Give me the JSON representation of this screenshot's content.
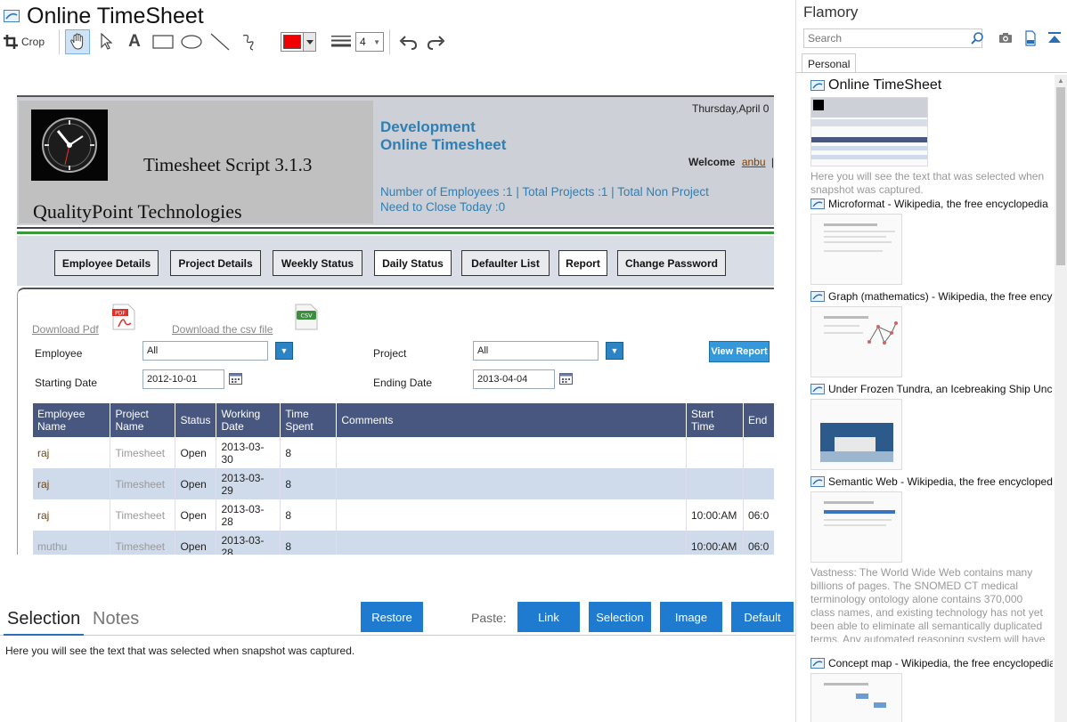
{
  "window": {
    "title": "Online TimeSheet"
  },
  "toolbar": {
    "crop_label": "Crop",
    "line_width": "4",
    "color": "#f00000"
  },
  "snapshot": {
    "script_title": "Timesheet Script  3.1.3",
    "company": "QualityPoint Technologies",
    "dev_line1": "Development",
    "dev_line2": "Online Timesheet",
    "date": "Thursday,April 0",
    "welcome": "Welcome",
    "user": "anbu",
    "user_sep": "|",
    "stats_line1": "Number of Employees :1  |  Total Projects :1  |  Total Non Project",
    "stats_line2": "Need to Close Today :0",
    "nav": [
      {
        "label": "Employee Details"
      },
      {
        "label": "Project Details"
      },
      {
        "label": "Weekly Status"
      },
      {
        "label": "Daily Status"
      },
      {
        "label": "Defaulter List"
      },
      {
        "label": "Report"
      },
      {
        "label": "Change Password"
      }
    ],
    "download_pdf": "Download Pdf",
    "download_csv": "Download the csv file",
    "pdf_badge": "PDF",
    "csv_badge": "CSV",
    "form": {
      "employee_label": "Employee",
      "employee_value": "All",
      "project_label": "Project",
      "project_value": "All",
      "start_label": "Starting Date",
      "start_value": "2012-10-01",
      "end_label": "Ending Date",
      "end_value": "2013-04-04",
      "view_report": "View Report"
    },
    "grid": {
      "headers": [
        "Employee Name",
        "Project Name",
        "Status",
        "Working Date",
        "Time Spent",
        "Comments",
        "Start Time",
        "End"
      ],
      "rows": [
        [
          "raj",
          "Timesheet",
          "Open",
          "2013-03-30",
          "8",
          "",
          "",
          ""
        ],
        [
          "raj",
          "Timesheet",
          "Open",
          "2013-03-29",
          "8",
          "",
          "",
          ""
        ],
        [
          "raj",
          "Timesheet",
          "Open",
          "2013-03-28",
          "8",
          "",
          "10:00:AM",
          "06:0"
        ],
        [
          "muthu",
          "Timesheet",
          "Open",
          "2013-03-28",
          "8",
          "",
          "10:00:AM",
          "06:0"
        ]
      ]
    }
  },
  "bottom": {
    "tab_selection": "Selection",
    "tab_notes": "Notes",
    "restore": "Restore",
    "paste_label": "Paste:",
    "paste_link": "Link",
    "paste_selection": "Selection",
    "paste_image": "Image",
    "paste_default": "Default",
    "selection_text": "Here you will see the text that was selected when snapshot was captured."
  },
  "sidebar": {
    "title": "Flamory",
    "search_placeholder": "Search",
    "tab": "Personal",
    "items": [
      {
        "title": "Online TimeSheet",
        "desc": "Here you will see the text that was selected when snapshot was captured."
      },
      {
        "title": "Microformat - Wikipedia, the free encyclopedia",
        "desc": ""
      },
      {
        "title": "Graph (mathematics) - Wikipedia, the free encyclopedia",
        "desc": ""
      },
      {
        "title": "Under Frozen Tundra, an Icebreaking Ship Uncovers",
        "desc": ""
      },
      {
        "title": "Semantic Web - Wikipedia, the free encyclopedia",
        "desc": "Vastness: The World Wide Web contains many billions of pages. The SNOMED CT medical terminology ontology alone contains 370,000 class names, and existing technology has not yet been able to eliminate all semantically duplicated terms. Any automated reasoning system will have to deal with truly huge inputs."
      },
      {
        "title": "Concept map - Wikipedia, the free encyclopedia",
        "desc": ""
      }
    ]
  }
}
